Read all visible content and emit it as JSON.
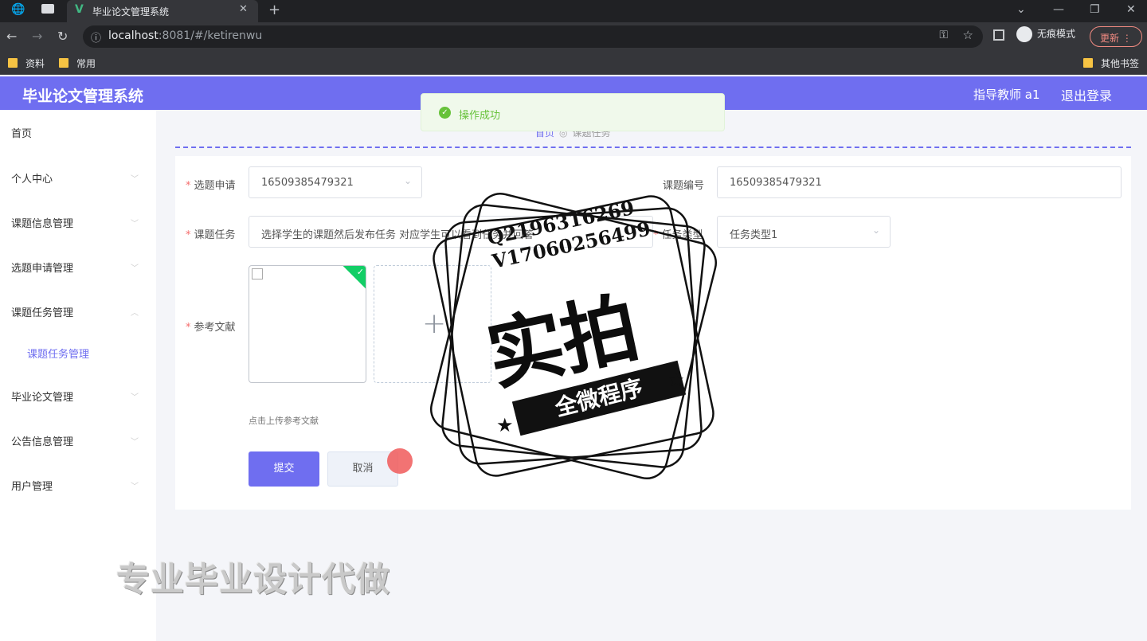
{
  "browser": {
    "tab_title": "毕业论文管理系统",
    "url_host": "localhost",
    "url_rest": ":8081/#/ketirenwu",
    "incognito_label": "无痕模式",
    "update_label": "更新",
    "bookmarks": [
      "资料",
      "常用"
    ],
    "other_bookmarks": "其他书签"
  },
  "header": {
    "brand": "毕业论文管理系统",
    "role": "指导教师 a1",
    "logout": "退出登录",
    "bg_color": "#6f6ef0"
  },
  "sidebar": {
    "items": [
      {
        "label": "首页"
      },
      {
        "label": "个人中心"
      },
      {
        "label": "课题信息管理"
      },
      {
        "label": "选题申请管理"
      },
      {
        "label": "课题任务管理"
      },
      {
        "label": "毕业论文管理"
      },
      {
        "label": "公告信息管理"
      },
      {
        "label": "用户管理"
      }
    ],
    "active_sub": "课题任务管理"
  },
  "breadcrumb": {
    "home": "首页",
    "current": "课题任务"
  },
  "toast": {
    "message": "操作成功",
    "type": "success"
  },
  "form": {
    "selection_label": "选题申请",
    "selection_value": "16509385479321",
    "topic_no_label": "课题编号",
    "topic_no_value": "16509385479321",
    "task_label": "课题任务",
    "task_value": "选择学生的课题然后发布任务 对应学生可以看到任务并回答",
    "task_type_label": "任务类型",
    "task_type_value": "任务类型1",
    "ref_label": "参考文献",
    "upload_tip": "点击上传参考文献",
    "submit_label": "提交",
    "cancel_label": "取消"
  },
  "watermark": {
    "qq": "Q2196316269",
    "vx": "V17060256499",
    "big": "实拍",
    "ribbon": "全微程序",
    "bottom": "专业毕业设计代做"
  }
}
